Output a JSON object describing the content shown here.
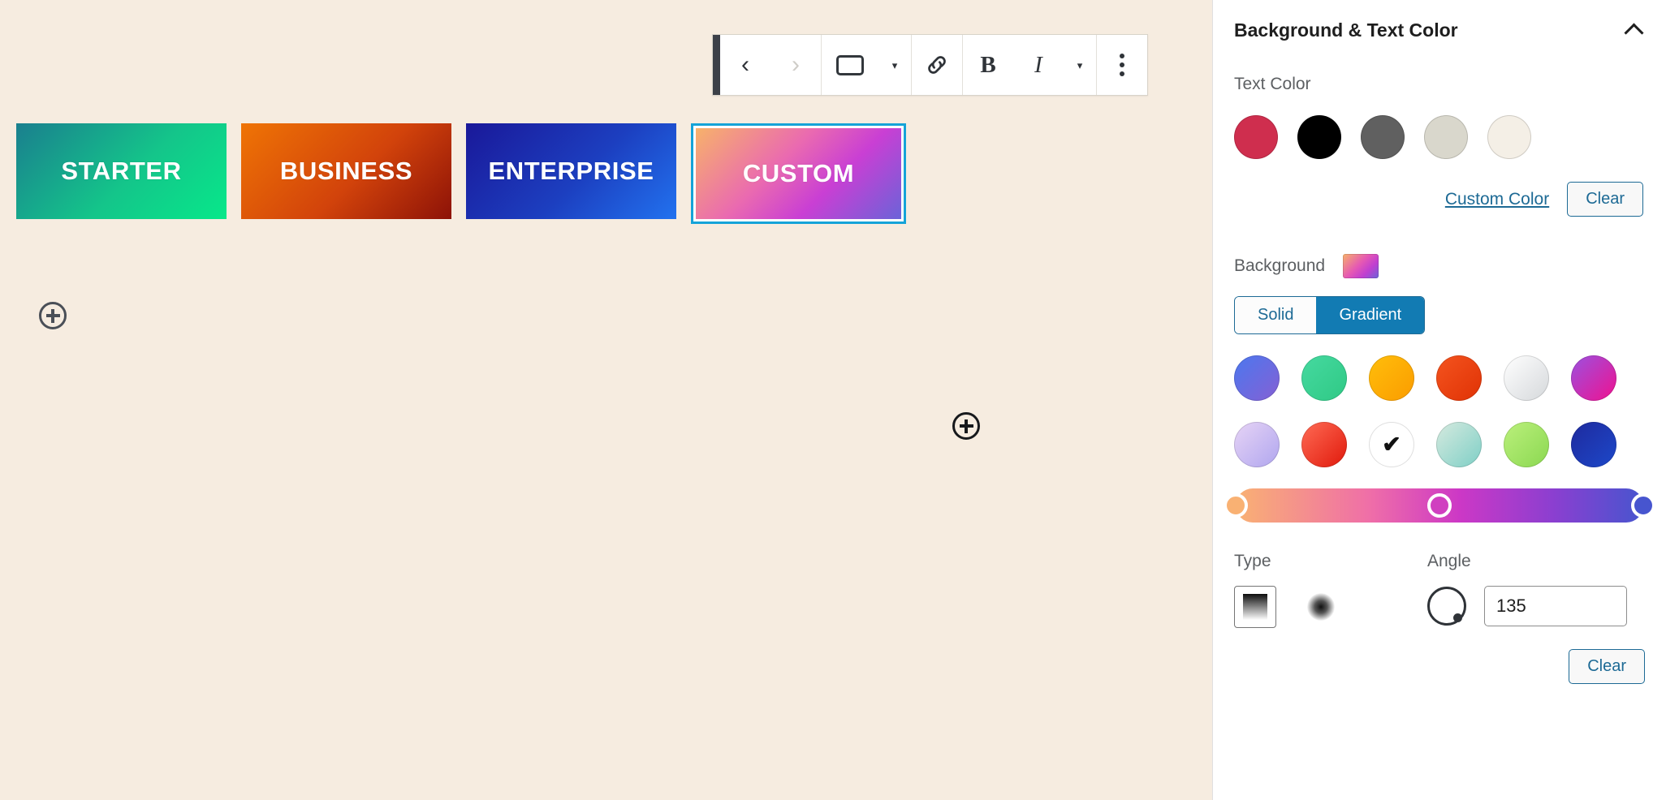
{
  "canvas": {
    "background_color": "#f6ece0",
    "toolbar": {
      "back_label": "‹",
      "forward_label": "›",
      "block_type_label": "Button",
      "block_caret": "▾",
      "link_label": "Link",
      "bold_label": "B",
      "italic_label": "I",
      "more_rich_text_caret": "▾",
      "options_label": "Options"
    },
    "buttons": [
      {
        "label": "STARTER",
        "gradient": "linear-gradient(135deg, #1a7f8e 0%, #14c58a 55%, #07e88a 100%)",
        "selected": false
      },
      {
        "label": "BUSINESS",
        "gradient": "linear-gradient(135deg, #ef7405 0%, #d2430b 55%, #8d1207 100%)",
        "selected": false
      },
      {
        "label": "ENTERPRISE",
        "gradient": "linear-gradient(135deg, #1a1899 0%, #1c3fc0 55%, #2272ef 100%)",
        "selected": false
      },
      {
        "label": "CUSTOM",
        "gradient": "linear-gradient(135deg, #f7b26a 0%, #ea6ab0 40%, #c93fd4 65%, #6b63d8 100%)",
        "selected": true
      }
    ],
    "inserters": [
      {
        "name": "add-block-left",
        "label": "+"
      },
      {
        "name": "add-block-right",
        "label": "+"
      }
    ]
  },
  "sidebar": {
    "panel_title": "Background & Text Color",
    "collapse_icon": "chevron-up",
    "text_color": {
      "label": "Text Color",
      "swatches": [
        {
          "name": "crimson",
          "color": "#cf2e4e"
        },
        {
          "name": "black",
          "color": "#000000"
        },
        {
          "name": "dark-gray",
          "color": "#606060"
        },
        {
          "name": "light-gray",
          "color": "#d9d7cc"
        },
        {
          "name": "cream",
          "color": "#f4efe6"
        }
      ],
      "custom_color_link": "Custom Color",
      "clear_label": "Clear"
    },
    "background": {
      "label": "Background",
      "preview_gradient": "linear-gradient(135deg, #f7b26a 0%, #e558b4 45%, #c13fd0 70%, #6b63d8 100%)",
      "tabs": [
        {
          "label": "Solid",
          "active": false
        },
        {
          "label": "Gradient",
          "active": true
        }
      ],
      "gradient_swatches": [
        [
          {
            "name": "blue-purple",
            "gradient": "linear-gradient(135deg,#4b78ef 0%,#8560d4 100%)",
            "selected": false
          },
          {
            "name": "green-mint",
            "gradient": "linear-gradient(135deg,#46d9a0 0%,#2fc985 100%)",
            "selected": false
          },
          {
            "name": "orange-yellow",
            "gradient": "linear-gradient(135deg,#ffbe0b 0%,#fb9c00 100%)",
            "selected": false
          },
          {
            "name": "red-orange",
            "gradient": "linear-gradient(135deg,#f4541f 0%,#e03205 100%)",
            "selected": false
          },
          {
            "name": "white-gray",
            "gradient": "linear-gradient(135deg,#ffffff 0%,#d5d8db 100%)",
            "selected": false
          },
          {
            "name": "purple-pink",
            "gradient": "linear-gradient(135deg,#9b51e0 0%,#f0118f 100%)",
            "selected": false
          }
        ],
        [
          {
            "name": "lavender",
            "gradient": "linear-gradient(135deg,#e7d4f5 0%,#b0a6ef 100%)",
            "selected": false
          },
          {
            "name": "red-bright",
            "gradient": "linear-gradient(135deg,#ff6b55 0%,#e0190b 100%)",
            "selected": false
          },
          {
            "name": "custom-active",
            "gradient": "linear-gradient(135deg,#8a4fb8 0%,#c2359a 100%)",
            "selected": true
          },
          {
            "name": "pale-teal",
            "gradient": "linear-gradient(135deg,#d6eadf 0%,#7ecfc6 100%)",
            "selected": false
          },
          {
            "name": "light-green",
            "gradient": "linear-gradient(135deg,#bbf07c 0%,#8bd851 100%)",
            "selected": false
          },
          {
            "name": "deep-blue",
            "gradient": "linear-gradient(135deg,#1e2a9e 0%,#1d48c9 100%)",
            "selected": false
          }
        ]
      ],
      "gradient_bar": "linear-gradient(90deg,#f9b173 0%, #ef6ea8 33%, #cc38c6 55%, #8b3fd0 78%, #4755cf 100%)",
      "gradient_stops": [
        {
          "position": 0,
          "color": "#f9b173"
        },
        {
          "position": 50,
          "color": "#d03fc0"
        },
        {
          "position": 100,
          "color": "#4755cf"
        }
      ],
      "type": {
        "label": "Type",
        "options": [
          {
            "name": "linear-gradient",
            "selected": true
          },
          {
            "name": "radial-gradient",
            "selected": false
          }
        ]
      },
      "angle": {
        "label": "Angle",
        "value": "135"
      },
      "clear_label": "Clear"
    }
  }
}
